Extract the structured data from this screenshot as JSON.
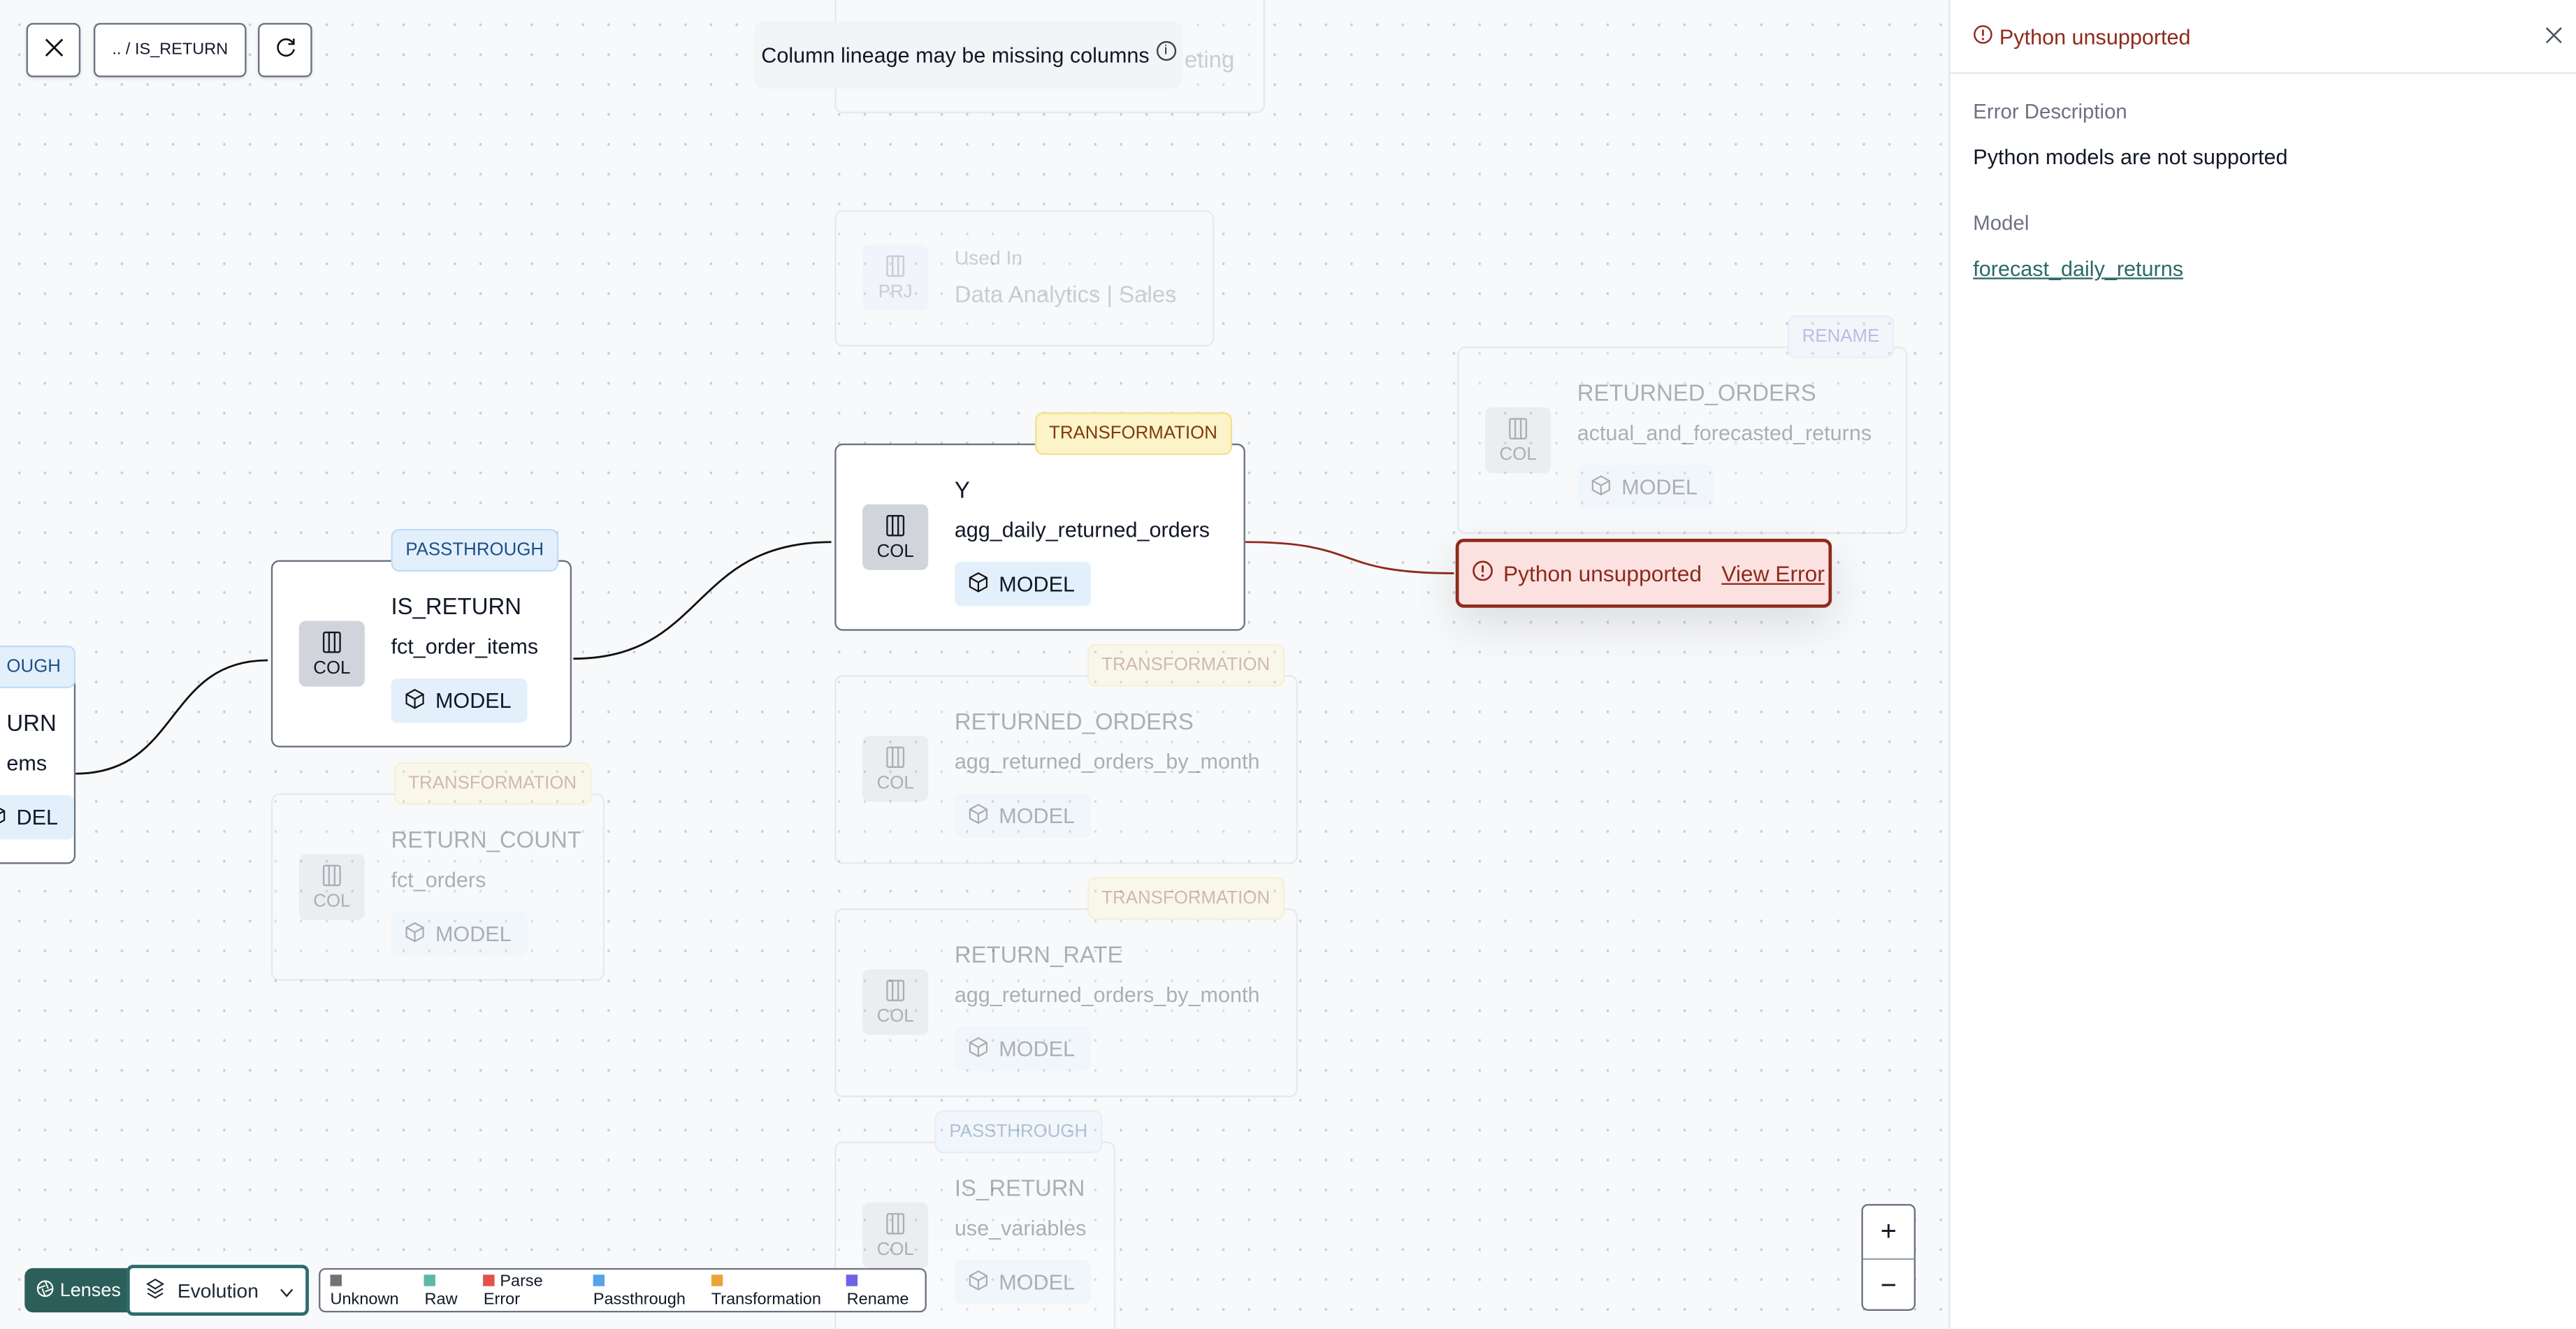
{
  "toolbar": {
    "close_icon": "x-icon",
    "breadcrumb": ".. / IS_RETURN",
    "refresh_icon": "refresh-icon"
  },
  "notice": {
    "text": "Column lineage may be missing columns",
    "icon": "info-icon"
  },
  "nodes": [
    {
      "id": "top-partial",
      "faded": true,
      "tile": "",
      "title": "",
      "subtitle": "eting",
      "chip": ""
    },
    {
      "id": "used-in",
      "faded": true,
      "tile": "PRJ",
      "title": "Used In",
      "subtitle": "Data Analytics | Sales",
      "chip": ""
    },
    {
      "id": "returned-orders-rename",
      "faded": true,
      "badge": "RENAME",
      "badge_type": "rename",
      "tile": "COL",
      "title": "RETURNED_ORDERS",
      "subtitle": "actual_and_forecasted_returns",
      "chip": "MODEL"
    },
    {
      "id": "y",
      "faded": false,
      "badge": "TRANSFORMATION",
      "badge_type": "transformation",
      "tile": "COL",
      "title": "Y",
      "subtitle": "agg_daily_returned_orders",
      "chip": "MODEL"
    },
    {
      "id": "is-return-main",
      "faded": false,
      "badge": "PASSTHROUGH",
      "badge_type": "passthrough",
      "tile": "COL",
      "title": "IS_RETURN",
      "subtitle": "fct_order_items",
      "chip": "MODEL"
    },
    {
      "id": "left-partial",
      "faded": false,
      "badge": "OUGH",
      "badge_type": "passthrough",
      "tile": "",
      "title": "URN",
      "subtitle": "ems",
      "chip": "DEL"
    },
    {
      "id": "return-count",
      "faded": true,
      "badge": "TRANSFORMATION",
      "badge_type": "transformation",
      "tile": "COL",
      "title": "RETURN_COUNT",
      "subtitle": "fct_orders",
      "chip": "MODEL"
    },
    {
      "id": "returned-orders",
      "faded": true,
      "badge": "TRANSFORMATION",
      "badge_type": "transformation",
      "tile": "COL",
      "title": "RETURNED_ORDERS",
      "subtitle": "agg_returned_orders_by_month",
      "chip": "MODEL"
    },
    {
      "id": "return-rate",
      "faded": true,
      "badge": "TRANSFORMATION",
      "badge_type": "transformation",
      "tile": "COL",
      "title": "RETURN_RATE",
      "subtitle": "agg_returned_orders_by_month",
      "chip": "MODEL"
    },
    {
      "id": "is-return-vars",
      "faded": true,
      "badge": "PASSTHROUGH",
      "badge_type": "passthrough",
      "tile": "COL",
      "title": "IS_RETURN",
      "subtitle": "use_variables",
      "chip": "MODEL"
    }
  ],
  "error_node": {
    "text": "Python unsupported",
    "link": "View Error",
    "color": "#8e2a1c"
  },
  "panel": {
    "title": "Python unsupported",
    "error_label": "Error Description",
    "error_text": "Python models are not supported",
    "model_label": "Model",
    "model_link": "forecast_daily_returns"
  },
  "zoom": {
    "in": "+",
    "out": "−"
  },
  "bottom": {
    "lenses": "Lenses",
    "lens_value": "Evolution",
    "legend": [
      {
        "label": "Unknown",
        "color": "#737373"
      },
      {
        "label": "Raw",
        "color": "#5bb8a6"
      },
      {
        "label": "Parse Error",
        "color": "#e0534a"
      },
      {
        "label": "Passthrough",
        "color": "#56a3e6"
      },
      {
        "label": "Transformation",
        "color": "#eaa43a"
      },
      {
        "label": "Rename",
        "color": "#6e62e6"
      }
    ]
  }
}
